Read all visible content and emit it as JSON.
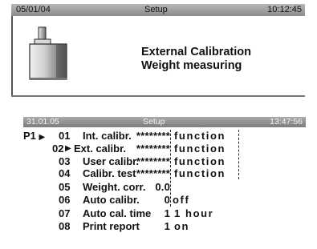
{
  "screen1": {
    "date": "05/01/04",
    "title": "Setup",
    "time": "10:12:45",
    "icon": "weight-icon",
    "message_line1": "External Calibration",
    "message_line2": "Weight measuring"
  },
  "screen2": {
    "date": "31.01.05",
    "title": "Setup",
    "time": "13:47:56",
    "page_label": "P1",
    "selector_arrow": "▶",
    "rows": [
      {
        "num": "01",
        "label": "Int. calibr.",
        "value": "********",
        "text": "function"
      },
      {
        "num": "02",
        "label": "Ext. calibr.",
        "value": "********",
        "text": "function"
      },
      {
        "num": "03",
        "label": "User calibr.",
        "value": "********",
        "text": "function"
      },
      {
        "num": "04",
        "label": "Calibr. test",
        "value": "********",
        "text": "function"
      },
      {
        "num": "05",
        "label": "Weight. corr.",
        "value": "0.0",
        "text": ""
      },
      {
        "num": "06",
        "label": "Auto calibr.",
        "value": "0",
        "text": "off"
      },
      {
        "num": "07",
        "label": "Auto cal. time",
        "value": "1",
        "text": "1 hour"
      },
      {
        "num": "08",
        "label": "Print report",
        "value": "1",
        "text": "on"
      }
    ]
  }
}
